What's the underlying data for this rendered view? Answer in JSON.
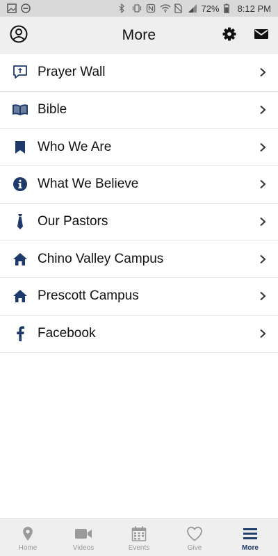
{
  "status_bar": {
    "battery": "72%",
    "time": "8:12 PM"
  },
  "header": {
    "title": "More"
  },
  "menu": {
    "items": [
      {
        "label": "Prayer Wall",
        "icon": "prayer-wall-icon"
      },
      {
        "label": "Bible",
        "icon": "bible-icon"
      },
      {
        "label": "Who We Are",
        "icon": "bookmark-icon"
      },
      {
        "label": "What We Believe",
        "icon": "info-icon"
      },
      {
        "label": "Our Pastors",
        "icon": "tie-icon"
      },
      {
        "label": "Chino Valley Campus",
        "icon": "home-icon"
      },
      {
        "label": "Prescott Campus",
        "icon": "home-icon"
      },
      {
        "label": "Facebook",
        "icon": "facebook-icon"
      }
    ]
  },
  "bottom_nav": {
    "tabs": [
      {
        "label": "Home",
        "icon": "location-pin-icon"
      },
      {
        "label": "Videos",
        "icon": "video-camera-icon"
      },
      {
        "label": "Events",
        "icon": "calendar-icon"
      },
      {
        "label": "Give",
        "icon": "heart-icon"
      },
      {
        "label": "More",
        "icon": "menu-icon"
      }
    ],
    "active": "More"
  },
  "colors": {
    "accent": "#1d3a6b",
    "inactive": "#9a9a9a",
    "appbar_bg": "#efefef",
    "statusbar_bg": "#d9d9d9"
  }
}
